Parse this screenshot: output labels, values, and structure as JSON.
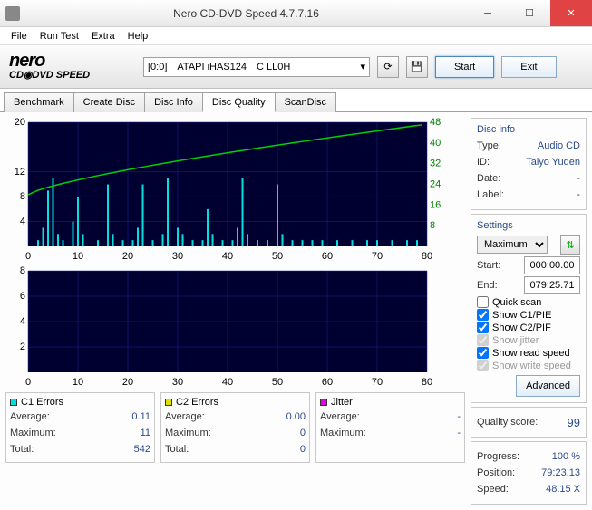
{
  "window": {
    "title": "Nero CD-DVD Speed 4.7.7.16"
  },
  "menu": {
    "file": "File",
    "run": "Run Test",
    "extra": "Extra",
    "help": "Help"
  },
  "logo": {
    "line1": "nero",
    "line2": "CD◉DVD SPEED"
  },
  "toolbar": {
    "drive": "[0:0] ATAPI iHAS124 C LL0H",
    "start": "Start",
    "exit": "Exit"
  },
  "tabs": {
    "benchmark": "Benchmark",
    "create": "Create Disc",
    "info": "Disc Info",
    "quality": "Disc Quality",
    "scan": "ScanDisc"
  },
  "disc_info": {
    "title": "Disc info",
    "type_k": "Type:",
    "type_v": "Audio CD",
    "id_k": "ID:",
    "id_v": "Taiyo Yuden",
    "date_k": "Date:",
    "date_v": "-",
    "label_k": "Label:",
    "label_v": "-"
  },
  "settings": {
    "title": "Settings",
    "speed": "Maximum",
    "start_k": "Start:",
    "start_v": "000:00.00",
    "end_k": "End:",
    "end_v": "079:25.71",
    "quick": "Quick scan",
    "c1": "Show C1/PIE",
    "c2": "Show C2/PIF",
    "jitter": "Show jitter",
    "read": "Show read speed",
    "write": "Show write speed",
    "advanced": "Advanced"
  },
  "quality": {
    "label": "Quality score:",
    "value": "99"
  },
  "progress": {
    "prog_k": "Progress:",
    "prog_v": "100 %",
    "pos_k": "Position:",
    "pos_v": "79:23.13",
    "spd_k": "Speed:",
    "spd_v": "48.15 X"
  },
  "stats": {
    "c1": {
      "name": "C1 Errors",
      "avg_k": "Average:",
      "avg_v": "0.11",
      "max_k": "Maximum:",
      "max_v": "11",
      "tot_k": "Total:",
      "tot_v": "542"
    },
    "c2": {
      "name": "C2 Errors",
      "avg_k": "Average:",
      "avg_v": "0.00",
      "max_k": "Maximum:",
      "max_v": "0",
      "tot_k": "Total:",
      "tot_v": "0"
    },
    "jit": {
      "name": "Jitter",
      "avg_k": "Average:",
      "avg_v": "-",
      "max_k": "Maximum:",
      "max_v": "-"
    }
  },
  "chart_data": [
    {
      "type": "bar",
      "title": "C1 Errors + Read Speed",
      "xlabel": "",
      "ylabel": "",
      "xlim": [
        0,
        80
      ],
      "ylim_left": [
        0,
        20
      ],
      "ylim_right": [
        0,
        48
      ],
      "x_ticks": [
        0,
        10,
        20,
        30,
        40,
        50,
        60,
        70,
        80
      ],
      "y_ticks_left": [
        4,
        8,
        12,
        20
      ],
      "y_ticks_right": [
        8,
        16,
        24,
        32,
        40,
        48
      ],
      "c1_bars": [
        {
          "x": 2,
          "h": 1
        },
        {
          "x": 3,
          "h": 3
        },
        {
          "x": 4,
          "h": 9
        },
        {
          "x": 5,
          "h": 11
        },
        {
          "x": 6,
          "h": 2
        },
        {
          "x": 7,
          "h": 1
        },
        {
          "x": 9,
          "h": 4
        },
        {
          "x": 10,
          "h": 8
        },
        {
          "x": 11,
          "h": 2
        },
        {
          "x": 14,
          "h": 1
        },
        {
          "x": 16,
          "h": 10
        },
        {
          "x": 17,
          "h": 2
        },
        {
          "x": 19,
          "h": 1
        },
        {
          "x": 21,
          "h": 1
        },
        {
          "x": 22,
          "h": 3
        },
        {
          "x": 23,
          "h": 10
        },
        {
          "x": 25,
          "h": 1
        },
        {
          "x": 27,
          "h": 2
        },
        {
          "x": 28,
          "h": 11
        },
        {
          "x": 30,
          "h": 3
        },
        {
          "x": 31,
          "h": 2
        },
        {
          "x": 33,
          "h": 1
        },
        {
          "x": 35,
          "h": 1
        },
        {
          "x": 36,
          "h": 6
        },
        {
          "x": 37,
          "h": 2
        },
        {
          "x": 39,
          "h": 1
        },
        {
          "x": 41,
          "h": 1
        },
        {
          "x": 42,
          "h": 3
        },
        {
          "x": 43,
          "h": 11
        },
        {
          "x": 44,
          "h": 2
        },
        {
          "x": 46,
          "h": 1
        },
        {
          "x": 48,
          "h": 1
        },
        {
          "x": 50,
          "h": 10
        },
        {
          "x": 51,
          "h": 2
        },
        {
          "x": 53,
          "h": 1
        },
        {
          "x": 55,
          "h": 1
        },
        {
          "x": 57,
          "h": 1
        },
        {
          "x": 59,
          "h": 1
        },
        {
          "x": 62,
          "h": 1
        },
        {
          "x": 65,
          "h": 1
        },
        {
          "x": 68,
          "h": 1
        },
        {
          "x": 70,
          "h": 1
        },
        {
          "x": 73,
          "h": 1
        },
        {
          "x": 76,
          "h": 1
        },
        {
          "x": 78,
          "h": 1
        }
      ],
      "speed_curve": {
        "start_x": 0,
        "start_y": 20,
        "end_x": 79,
        "end_y": 47
      }
    },
    {
      "type": "bar",
      "title": "C2 Errors",
      "xlabel": "",
      "ylabel": "",
      "xlim": [
        0,
        80
      ],
      "ylim": [
        0,
        8
      ],
      "x_ticks": [
        0,
        10,
        20,
        30,
        40,
        50,
        60,
        70,
        80
      ],
      "y_ticks": [
        2,
        4,
        6,
        8
      ],
      "c2_bars": []
    }
  ]
}
